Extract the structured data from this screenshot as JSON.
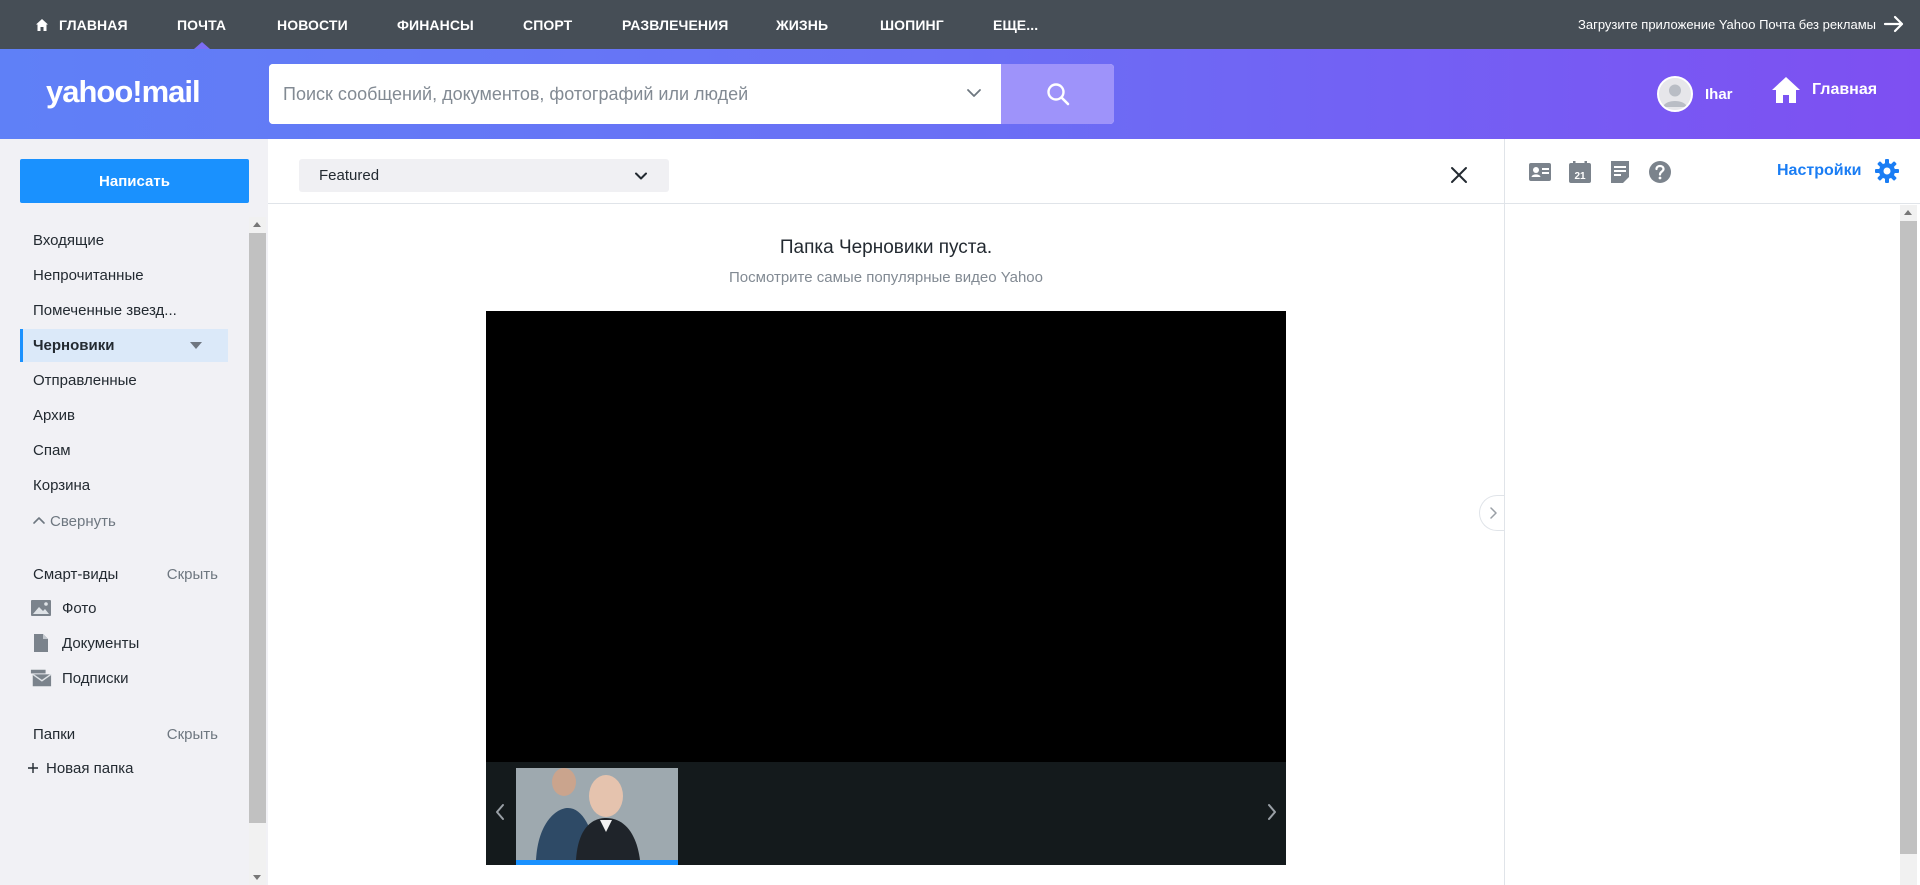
{
  "topnav": {
    "items": [
      {
        "label": "ГЛАВНАЯ",
        "icon": "home-icon"
      },
      {
        "label": "ПОЧТА",
        "active": true
      },
      {
        "label": "НОВОСТИ"
      },
      {
        "label": "ФИНАНСЫ"
      },
      {
        "label": "СПОРТ"
      },
      {
        "label": "РАЗВЛЕЧЕНИЯ"
      },
      {
        "label": "ЖИЗНЬ"
      },
      {
        "label": "ШОПИНГ"
      },
      {
        "label": "ЕЩЕ..."
      }
    ],
    "promo": "Загрузите приложение Yahoo Почта без рекламы",
    "promo_icon": "arrow-right-icon"
  },
  "header": {
    "logo": "yahoo!mail",
    "search_placeholder": "Поиск сообщений, документов, фотографий или людей",
    "search_icon": "search-icon",
    "user_name": "Ihar",
    "home_label": "Главная",
    "gradient": [
      "#5f80f7",
      "#7e4ff2"
    ]
  },
  "sidebar": {
    "compose_label": "Написать",
    "folders": [
      {
        "label": "Входящие"
      },
      {
        "label": "Непрочитанные"
      },
      {
        "label": "Помеченные звезд..."
      },
      {
        "label": "Черновики",
        "active": true
      },
      {
        "label": "Отправленные"
      },
      {
        "label": "Архив"
      },
      {
        "label": "Спам"
      },
      {
        "label": "Корзина"
      }
    ],
    "collapse_label": "Свернуть",
    "smart_views": {
      "title": "Смарт-виды",
      "hide_label": "Скрыть",
      "items": [
        {
          "label": "Фото",
          "icon": "photo-icon"
        },
        {
          "label": "Документы",
          "icon": "document-icon"
        },
        {
          "label": "Подписки",
          "icon": "subscriptions-icon"
        }
      ]
    },
    "folders_section": {
      "title": "Папки",
      "hide_label": "Скрыть",
      "new_folder_label": "Новая папка"
    }
  },
  "main": {
    "filter_value": "Featured",
    "empty_title": "Папка Черновики пуста.",
    "empty_subtitle": "Посмотрите самые популярные видео Yahoo"
  },
  "rightpanel": {
    "icons": [
      "contacts-icon",
      "calendar-icon",
      "notepad-icon",
      "help-icon"
    ],
    "calendar_day": "21",
    "settings_label": "Настройки"
  },
  "colors": {
    "accent": "#1a91fe",
    "topnav_bg": "#464e56",
    "settings_text": "#1a7df4"
  }
}
